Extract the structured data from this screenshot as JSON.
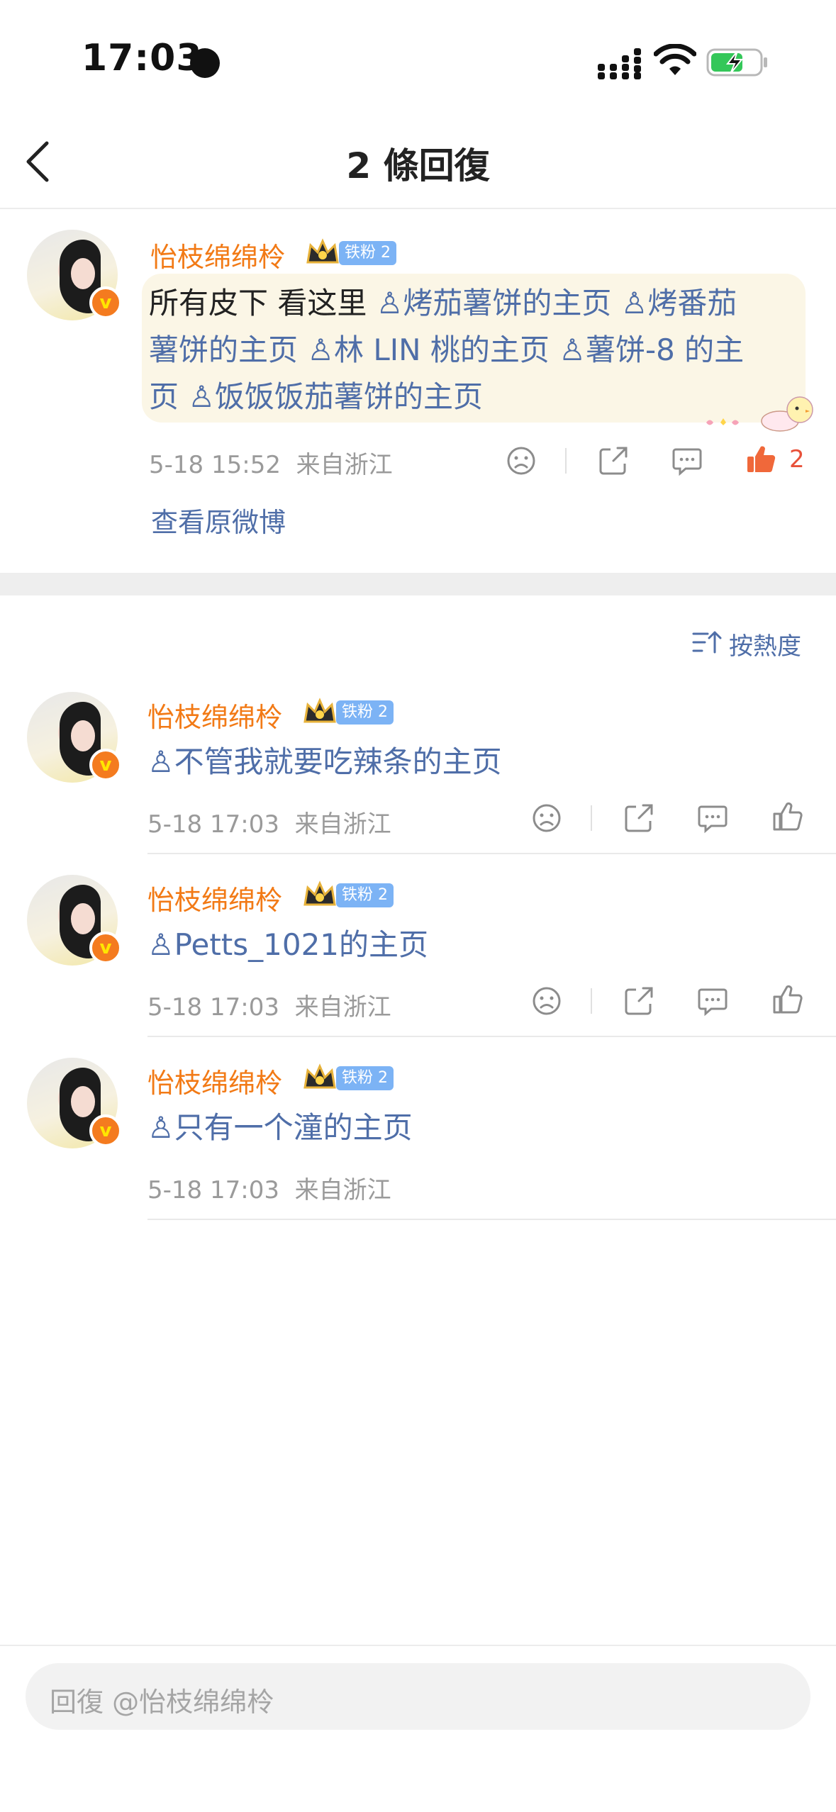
{
  "status_bar": {
    "time": "17:03"
  },
  "header": {
    "title": "2 條回復"
  },
  "main_comment": {
    "username": "怡枝绵绵柃",
    "fan_badge": "铁粉 2",
    "text_lines": [
      {
        "plain": "所有皮下 看这里 ",
        "links": [
          "烤茄薯饼的主页",
          "烤番茄"
        ]
      },
      {
        "plain": "",
        "links": [
          "薯饼的主页",
          "林 LIN 桃的主页",
          "薯饼-8 的主"
        ]
      },
      {
        "plain": "",
        "links": [
          "页",
          "饭饭饭茄薯饼的主页"
        ]
      }
    ],
    "line1_plain": "所有皮下 看这里 ",
    "line1_link1": "烤茄薯饼的主页",
    "line1_link2": "烤番茄",
    "line2_link1": "薯饼的主页",
    "line2_link2": "林 LIN 桃的主页",
    "line2_link3": "薯饼-8 的主",
    "line3_link1": "页",
    "line3_link2": "饭饭饭茄薯饼的主页",
    "timestamp": "5-18 15:52",
    "location": "来自浙江",
    "like_count": "2",
    "view_original": "查看原微博"
  },
  "sort_label": "按熱度",
  "replies": [
    {
      "username": "怡枝绵绵柃",
      "fan_badge": "铁粉 2",
      "mention": "不管我就要吃辣条的主页",
      "timestamp": "5-18 17:03",
      "location": "来自浙江"
    },
    {
      "username": "怡枝绵绵柃",
      "fan_badge": "铁粉 2",
      "mention": "Petts_1021的主页",
      "timestamp": "5-18 17:03",
      "location": "来自浙江"
    },
    {
      "username": "怡枝绵绵柃",
      "fan_badge": "铁粉 2",
      "mention": "只有一个潼的主页",
      "timestamp": "5-18 17:03",
      "location": "来自浙江"
    }
  ],
  "reply_input": {
    "placeholder": "回復 @怡枝绵绵柃"
  },
  "colors": {
    "username": "#f27a16",
    "link": "#4f6ea8",
    "like_active": "#e8513a",
    "fan_badge": "#7cb3f5"
  }
}
